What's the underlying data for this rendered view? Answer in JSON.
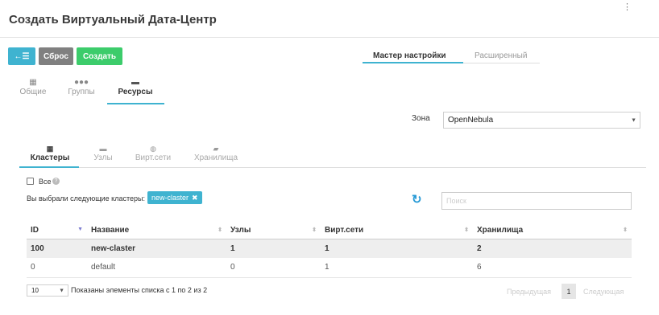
{
  "header": {
    "title": "Создать Виртуальный Дата-Центр",
    "menu_dots": "⋮"
  },
  "toolbar": {
    "back_icon": "←☰",
    "reset_label": "Сброс",
    "create_label": "Создать"
  },
  "mode_tabs": {
    "wizard": "Мастер настройки",
    "advanced": "Расширенный"
  },
  "main_tabs": [
    {
      "label": "Общие",
      "icon": "grid-icon"
    },
    {
      "label": "Группы",
      "icon": "users-icon"
    },
    {
      "label": "Ресурсы",
      "icon": "server-icon",
      "active": true
    }
  ],
  "zone": {
    "label": "Зона",
    "value": "OpenNebula"
  },
  "sub_tabs": [
    {
      "label": "Кластеры",
      "icon": "th-icon",
      "active": true
    },
    {
      "label": "Узлы",
      "icon": "hdd-icon"
    },
    {
      "label": "Вирт.сети",
      "icon": "globe-icon"
    },
    {
      "label": "Хранилища",
      "icon": "folder-icon"
    }
  ],
  "clusters": {
    "all_label": "Все",
    "chosen_label": "Вы выбрали следующие кластеры:",
    "chosen_tag": "new-claster",
    "search_placeholder": "Поиск",
    "columns": [
      "ID",
      "Название",
      "Узлы",
      "Вирт.сети",
      "Хранилища"
    ],
    "rows": [
      {
        "id": "100",
        "name": "new-claster",
        "hosts": "1",
        "vnets": "1",
        "datastores": "2",
        "selected": true
      },
      {
        "id": "0",
        "name": "default",
        "hosts": "0",
        "vnets": "1",
        "datastores": "6"
      }
    ],
    "page_length": "10",
    "info": "Показаны элементы списка с 1 по 2 из 2",
    "prev": "Предыдущая",
    "page": "1",
    "next": "Следующая"
  },
  "colors": {
    "accent": "#3fb3d0",
    "create": "#3ccc6b",
    "reset": "#808080"
  }
}
